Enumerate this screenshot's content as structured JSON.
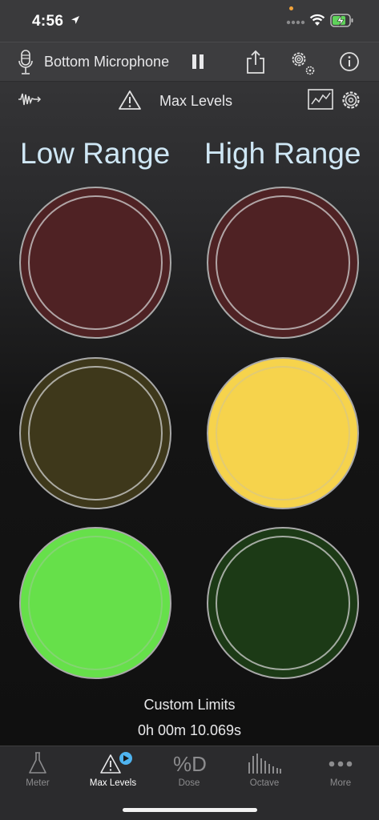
{
  "status_bar": {
    "time": "4:56"
  },
  "toolbar": {
    "microphone_label": "Bottom Microphone",
    "mode_label": "Max Levels"
  },
  "ranges": {
    "low_title": "Low Range",
    "high_title": "High Range"
  },
  "lights": {
    "low": [
      {
        "name": "low-red-light",
        "color": "#4f2224",
        "lit": false
      },
      {
        "name": "low-yellow-light",
        "color": "#3e381b",
        "lit": false
      },
      {
        "name": "low-green-light",
        "color": "#66e04a",
        "lit": true
      }
    ],
    "high": [
      {
        "name": "high-red-light",
        "color": "#4f2224",
        "lit": false
      },
      {
        "name": "high-yellow-light",
        "color": "#f6d34c",
        "lit": true
      },
      {
        "name": "high-green-light",
        "color": "#1c3a16",
        "lit": false
      }
    ]
  },
  "footer": {
    "limits_label": "Custom Limits",
    "elapsed": "0h 00m 10.069s"
  },
  "tabs": [
    {
      "label": "Meter",
      "icon": "flask-icon",
      "active": false
    },
    {
      "label": "Max Levels",
      "icon": "warning-triangle-icon",
      "active": true
    },
    {
      "label": "Dose",
      "icon": "percent-d-icon",
      "active": false
    },
    {
      "label": "Octave",
      "icon": "spectrum-bars-icon",
      "active": false
    },
    {
      "label": "More",
      "icon": "ellipsis-icon",
      "active": false
    }
  ],
  "colors": {
    "title_blue": "#cfe7f5",
    "play_badge": "#4fb4f0"
  }
}
